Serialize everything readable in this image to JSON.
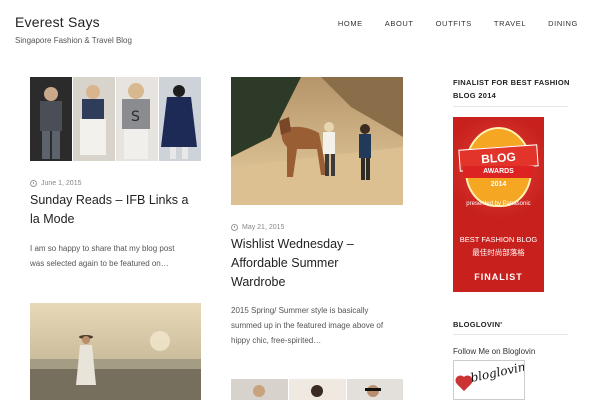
{
  "header": {
    "site_title": "Everest Says",
    "tagline": "Singapore Fashion & Travel Blog"
  },
  "nav": {
    "items": [
      "HOME",
      "ABOUT",
      "OUTFITS",
      "TRAVEL",
      "DINING"
    ]
  },
  "posts": [
    {
      "date": "June 1, 2015",
      "title_line1": "Sunday Reads – IFB Links a",
      "title_line2": "la Mode",
      "excerpt_line1": "I am so happy to share that my blog post",
      "excerpt_line2": "was selected again to be featured on…"
    },
    {
      "date": "May 21, 2015",
      "title_line1": "Wishlist Wednesday –",
      "title_line2": "Affordable Summer",
      "title_line3": "Wardrobe",
      "excerpt_line1": "2015 Spring/ Summer style is basically",
      "excerpt_line2": "summed up in the featured image above of",
      "excerpt_line3": "hippy chic, free-spirited…"
    }
  ],
  "sidebar": {
    "finalist_title_line1": "FINALIST FOR BEST FASHION",
    "finalist_title_line2": "BLOG 2014",
    "badge": {
      "ribbon_main": "BLOG",
      "ribbon_sub": "AWARDS",
      "year": "2014",
      "sponsor": "presented by Panasonic",
      "category": "BEST FASHION BLOG",
      "category_cn": "最佳时尚部落格",
      "label": "FINALIST"
    },
    "bloglovin_title": "BLOGLOVIN'",
    "follow_text": "Follow Me on Bloglovin",
    "bloglovin_logo": "bloglovin'"
  },
  "icons": {
    "date": "clock-icon"
  }
}
